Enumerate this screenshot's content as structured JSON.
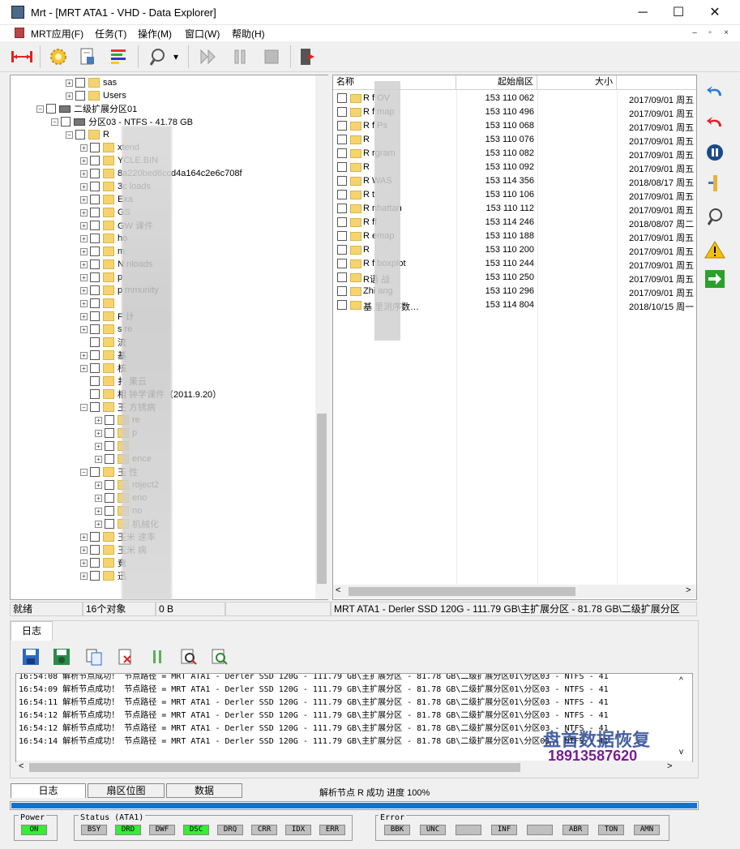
{
  "window": {
    "title": "Mrt - [MRT ATA1 - VHD - Data Explorer]",
    "minimize": "─",
    "maximize": "☐",
    "close": "✕"
  },
  "menu": {
    "items": [
      "MRT应用(F)",
      "任务(T)",
      "操作(M)",
      "窗口(W)",
      "帮助(H)"
    ],
    "mdi": [
      "–",
      "▫",
      "×"
    ]
  },
  "toolbar": {
    "icons": [
      "connect-icon",
      "settings-gear-icon",
      "file-report-icon",
      "sector-view-icon",
      "scan-icon",
      "play-icon",
      "pause-icon",
      "stop-icon",
      "exit-icon"
    ],
    "dropdown": "▾"
  },
  "tree": {
    "rows": [
      {
        "label": "sas",
        "level": 4,
        "exp": "+",
        "icon": "folder"
      },
      {
        "label": "Users",
        "level": 4,
        "exp": "+",
        "icon": "folder"
      },
      {
        "label": "二级扩展分区01",
        "level": 2,
        "exp": "-",
        "icon": "drive"
      },
      {
        "label": "分区03 - NTFS - 41.78 GB",
        "level": 3,
        "exp": "-",
        "icon": "drive"
      },
      {
        "label": "R",
        "level": 4,
        "exp": "-",
        "icon": "folder"
      },
      {
        "label": "xtend",
        "level": 5,
        "exp": "+",
        "icon": "folder"
      },
      {
        "label": "YCLE.BIN",
        "level": 5,
        "exp": "+",
        "icon": "folder"
      },
      {
        "label": "8a220bed6ccd4a164c2e6c708f",
        "level": 5,
        "exp": "+",
        "icon": "folder"
      },
      {
        "label": "3c            loads",
        "level": 5,
        "exp": "+",
        "icon": "folder"
      },
      {
        "label": "Exa",
        "level": 5,
        "exp": "+",
        "icon": "folder"
      },
      {
        "label": "GS",
        "level": 5,
        "exp": "+",
        "icon": "folder"
      },
      {
        "label": "GW           课件",
        "level": 5,
        "exp": "+",
        "icon": "folder"
      },
      {
        "label": "ho",
        "level": 5,
        "exp": "+",
        "icon": "folder"
      },
      {
        "label": "m",
        "level": 5,
        "exp": "+",
        "icon": "folder"
      },
      {
        "label": "N          nloads",
        "level": 5,
        "exp": "+",
        "icon": "folder"
      },
      {
        "label": "p",
        "level": 5,
        "exp": "+",
        "icon": "folder"
      },
      {
        "label": "p         mmunity",
        "level": 5,
        "exp": "+",
        "icon": "folder"
      },
      {
        "label": "",
        "level": 5,
        "exp": "+",
        "icon": "folder"
      },
      {
        "label": "F          计",
        "level": 5,
        "exp": "+",
        "icon": "folder"
      },
      {
        "label": "s          re",
        "level": 5,
        "exp": "+",
        "icon": "folder"
      },
      {
        "label": "           流",
        "level": 5,
        "exp": "",
        "icon": "folder"
      },
      {
        "label": "基",
        "level": 5,
        "exp": "+",
        "icon": "folder"
      },
      {
        "label": "            核",
        "level": 5,
        "exp": "+",
        "icon": "folder"
      },
      {
        "label": "扌         果云",
        "level": 5,
        "exp": "",
        "icon": "folder"
      },
      {
        "label": "相         钟学课件（2011.9.20）",
        "level": 5,
        "exp": "",
        "icon": "folder"
      },
      {
        "label": "王          方锈病",
        "level": 5,
        "exp": "-",
        "icon": "folder"
      },
      {
        "label": "re",
        "level": 6,
        "exp": "+",
        "icon": "folder"
      },
      {
        "label": "p",
        "level": 6,
        "exp": "+",
        "icon": "folder"
      },
      {
        "label": "",
        "level": 6,
        "exp": "+",
        "icon": "folder"
      },
      {
        "label": "ence",
        "level": 6,
        "exp": "+",
        "icon": "folder"
      },
      {
        "label": "玉          性",
        "level": 5,
        "exp": "-",
        "icon": "folder"
      },
      {
        "label": "roject2",
        "level": 6,
        "exp": "+",
        "icon": "folder"
      },
      {
        "label": "eno",
        "level": 6,
        "exp": "+",
        "icon": "folder"
      },
      {
        "label": "no",
        "level": 6,
        "exp": "+",
        "icon": "folder"
      },
      {
        "label": "机械化",
        "level": 6,
        "exp": "+",
        "icon": "folder"
      },
      {
        "label": "玉米         速率",
        "level": 5,
        "exp": "+",
        "icon": "folder"
      },
      {
        "label": "玉米         病",
        "level": 5,
        "exp": "+",
        "icon": "folder"
      },
      {
        "label": "竟",
        "level": 5,
        "exp": "+",
        "icon": "folder"
      },
      {
        "label": "迅",
        "level": 5,
        "exp": "+",
        "icon": "folder"
      }
    ]
  },
  "list": {
    "columns": [
      "名称",
      "起始扇区",
      "大小"
    ],
    "rows": [
      {
        "name": "R f         OV",
        "sector": "153 110 062",
        "size": "",
        "date": "2017/09/01 周五"
      },
      {
        "name": "R f         map",
        "sector": "153 110 496",
        "size": "",
        "date": "2017/09/01 周五"
      },
      {
        "name": "R f         Ps",
        "sector": "153 110 068",
        "size": "",
        "date": "2017/09/01 周五"
      },
      {
        "name": "R",
        "sector": "153 110 076",
        "size": "",
        "date": "2017/09/01 周五"
      },
      {
        "name": "R          rgram",
        "sector": "153 110 082",
        "size": "",
        "date": "2017/09/01 周五"
      },
      {
        "name": "R",
        "sector": "153 110 092",
        "size": "",
        "date": "2017/09/01 周五"
      },
      {
        "name": "R          WAS",
        "sector": "153 114 356",
        "size": "",
        "date": "2018/08/17 周五"
      },
      {
        "name": "R          t",
        "sector": "153 110 106",
        "size": "",
        "date": "2017/09/01 周五"
      },
      {
        "name": "R          nhattan",
        "sector": "153 110 112",
        "size": "",
        "date": "2017/09/01 周五"
      },
      {
        "name": "R          ff",
        "sector": "153 114 246",
        "size": "",
        "date": "2018/08/07 周二"
      },
      {
        "name": "R          emap",
        "sector": "153 110 188",
        "size": "",
        "date": "2017/09/01 周五"
      },
      {
        "name": "R",
        "sector": "153 110 200",
        "size": "",
        "date": "2017/09/01 周五"
      },
      {
        "name": "R f        boxplot",
        "sector": "153 110 244",
        "size": "",
        "date": "2017/09/01 周五"
      },
      {
        "name": "R语        战",
        "sector": "153 110 250",
        "size": "",
        "date": "2017/09/01 周五"
      },
      {
        "name": "Zhi        ang",
        "sector": "153 110 296",
        "size": "",
        "date": "2017/09/01 周五"
      },
      {
        "name": "基         里测序数…",
        "sector": "153 114 804",
        "size": "",
        "date": "2018/10/15 周一"
      }
    ]
  },
  "rightbar": {
    "icons": [
      "undo-icon",
      "redo-icon",
      "pause-circle-icon",
      "split-icon",
      "scan-icon",
      "warning-icon",
      "go-arrow-icon"
    ]
  },
  "status": {
    "ready": "就绪",
    "count": "16个对象",
    "size": "0 B",
    "path": "MRT ATA1 - Derler SSD 120G - 111.79 GB\\主扩展分区 - 81.78 GB\\二级扩展分区"
  },
  "log": {
    "tab": "日志",
    "toolbar_icons": [
      "save-icon",
      "save-as-icon",
      "copy-icon",
      "delete-icon",
      "pause-icon",
      "search-icon",
      "find-next-icon"
    ],
    "lines": [
      {
        "time": "16:54:08",
        "text": "解析节点成功！ 节点路径 = MRT ATA1 - Derler SSD 120G - 111.79 GB\\主扩展分区 - 81.78 GB\\二级扩展分区01\\分区03 - NTFS - 41"
      },
      {
        "time": "16:54:09",
        "text": "解析节点成功！ 节点路径 = MRT ATA1 - Derler SSD 120G - 111.79 GB\\主扩展分区 - 81.78 GB\\二级扩展分区01\\分区03 - NTFS - 41"
      },
      {
        "time": "16:54:11",
        "text": "解析节点成功！ 节点路径 = MRT ATA1 - Derler SSD 120G - 111.79 GB\\主扩展分区 - 81.78 GB\\二级扩展分区01\\分区03 - NTFS - 41"
      },
      {
        "time": "16:54:12",
        "text": "解析节点成功！ 节点路径 = MRT ATA1 - Derler SSD 120G - 111.79 GB\\主扩展分区 - 81.78 GB\\二级扩展分区01\\分区03 - NTFS - 41"
      },
      {
        "time": "16:54:12",
        "text": "解析节点成功！ 节点路径 = MRT ATA1 - Derler SSD 120G - 111.79 GB\\主扩展分区 - 81.78 GB\\二级扩展分区01\\分区03 - NTFS - 41"
      },
      {
        "time": "16:54:14",
        "text": "解析节点成功！ 节点路径 = MRT ATA1 - Derler SSD 120G - 111.79 GB\\主扩展分区 - 81.78 GB\\二级扩展分区01\\分区03 - NTFS - 41"
      }
    ],
    "watermark_name": "盘首数据恢复",
    "watermark_phone": "18913587620"
  },
  "bottom_tabs": [
    "日志",
    "扇区位图",
    "数据"
  ],
  "progress": {
    "text": "解析节点 R 成功  进度 100%",
    "value": 1.0
  },
  "indicators": {
    "power": {
      "title": "Power",
      "leds": [
        {
          "label": "ON",
          "on": true
        }
      ]
    },
    "status": {
      "title": "Status (ATA1)",
      "leds": [
        {
          "label": "BSY",
          "on": false
        },
        {
          "label": "DRD",
          "on": true
        },
        {
          "label": "DWF",
          "on": false
        },
        {
          "label": "DSC",
          "on": true
        },
        {
          "label": "DRQ",
          "on": false
        },
        {
          "label": "CRR",
          "on": false
        },
        {
          "label": "IDX",
          "on": false
        },
        {
          "label": "ERR",
          "on": false
        }
      ]
    },
    "error": {
      "title": "Error",
      "leds": [
        {
          "label": "BBK",
          "on": false
        },
        {
          "label": "UNC",
          "on": false
        },
        {
          "label": "",
          "on": false
        },
        {
          "label": "INF",
          "on": false
        },
        {
          "label": "",
          "on": false
        },
        {
          "label": "ABR",
          "on": false
        },
        {
          "label": "TON",
          "on": false
        },
        {
          "label": "AMN",
          "on": false
        }
      ]
    }
  }
}
